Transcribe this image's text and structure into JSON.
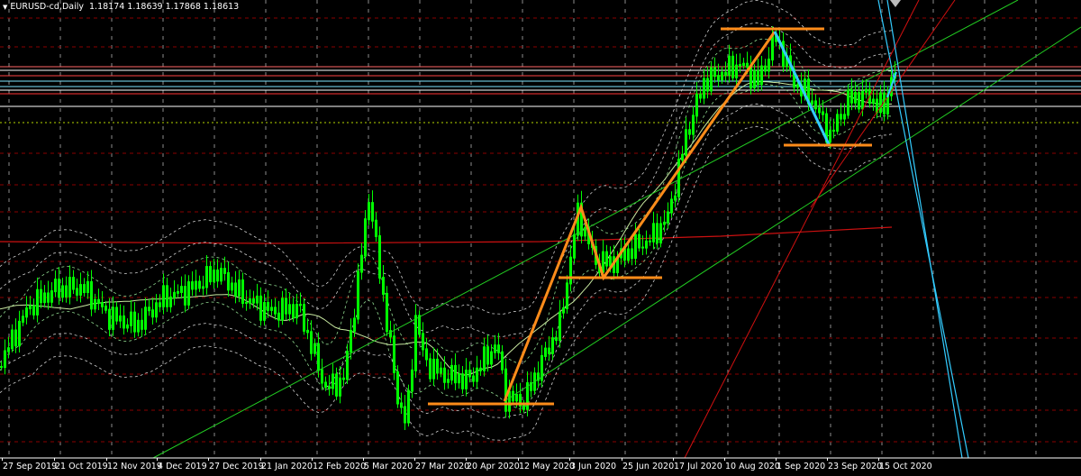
{
  "header": {
    "symbol": "EURUSD-cd,Daily",
    "ohlc": "1.18174 1.18639 1.17868 1.18613"
  },
  "colors": {
    "background": "#000000",
    "bull_candle": "#00ff00",
    "grid": "#8a0000",
    "fib_cyan": "#7fe6ff",
    "fib_white": "#ffffff",
    "pattern_orange": "#ff8c1a",
    "pattern_cyan": "#33ccff",
    "trend_green": "#22cc22",
    "trend_red": "#d01010",
    "envelope_white_dashed": "#c8c8c8",
    "envelope_green_dashed": "#8fd88f"
  },
  "chart_data": {
    "type": "candlestick",
    "instrument": "EURUSD-cd",
    "timeframe": "Daily",
    "last_bar": {
      "open": 1.18174,
      "high": 1.18639,
      "low": 1.17868,
      "close": 1.18613
    },
    "x_tick_labels": [
      "27 Sep 2019",
      "21 Oct 2019",
      "12 Nov 2019",
      "4 Dec 2019",
      "27 Dec 2019",
      "21 Jan 2020",
      "12 Feb 2020",
      "5 Mar 2020",
      "27 Mar 2020",
      "20 Apr 2020",
      "12 May 2020",
      "3 Jun 2020",
      "25 Jun 2020",
      "17 Jul 2020",
      "10 Aug 2020",
      "1 Sep 2020",
      "23 Sep 2020",
      "15 Oct 2020"
    ],
    "series_closes": [
      1.092,
      1.094,
      1.1,
      1.108,
      1.114,
      1.112,
      1.108,
      1.11,
      1.104,
      1.106,
      1.102,
      1.106,
      1.11,
      1.106,
      1.108,
      1.112,
      1.116,
      1.118,
      1.112,
      1.11,
      1.106,
      1.102,
      1.098,
      1.092,
      1.086,
      1.082,
      1.09,
      1.1,
      1.118,
      1.136,
      1.12,
      1.1,
      1.092,
      1.07,
      1.08,
      1.09,
      1.096,
      1.084,
      1.088,
      1.084,
      1.08,
      1.078,
      1.086,
      1.094,
      1.096,
      1.088,
      1.082,
      1.086,
      1.09,
      1.098,
      1.116,
      1.128,
      1.134,
      1.128,
      1.118,
      1.124,
      1.128,
      1.134,
      1.142,
      1.15,
      1.164,
      1.172,
      1.182,
      1.178,
      1.184,
      1.19,
      1.18,
      1.186,
      1.192,
      1.184,
      1.174,
      1.168,
      1.16,
      1.168,
      1.172,
      1.176,
      1.18,
      1.176,
      1.186
    ],
    "annotations": {
      "horizontal_levels_orange": [
        {
          "from": "27 Mar 2020",
          "to": "12 May 2020",
          "label": ""
        },
        {
          "from": "3 Jun 2020",
          "to": "25 Jun 2020",
          "label": ""
        },
        {
          "from": "10 Aug 2020",
          "to": "1 Sep 2020",
          "label": ""
        },
        {
          "from": "23 Sep 2020",
          "to": "15 Oct 2020",
          "label": ""
        }
      ],
      "zigzag_orange": true,
      "zigzag_cyan": true,
      "trendlines": [
        "green",
        "red",
        "cyan"
      ]
    },
    "grid": true
  }
}
